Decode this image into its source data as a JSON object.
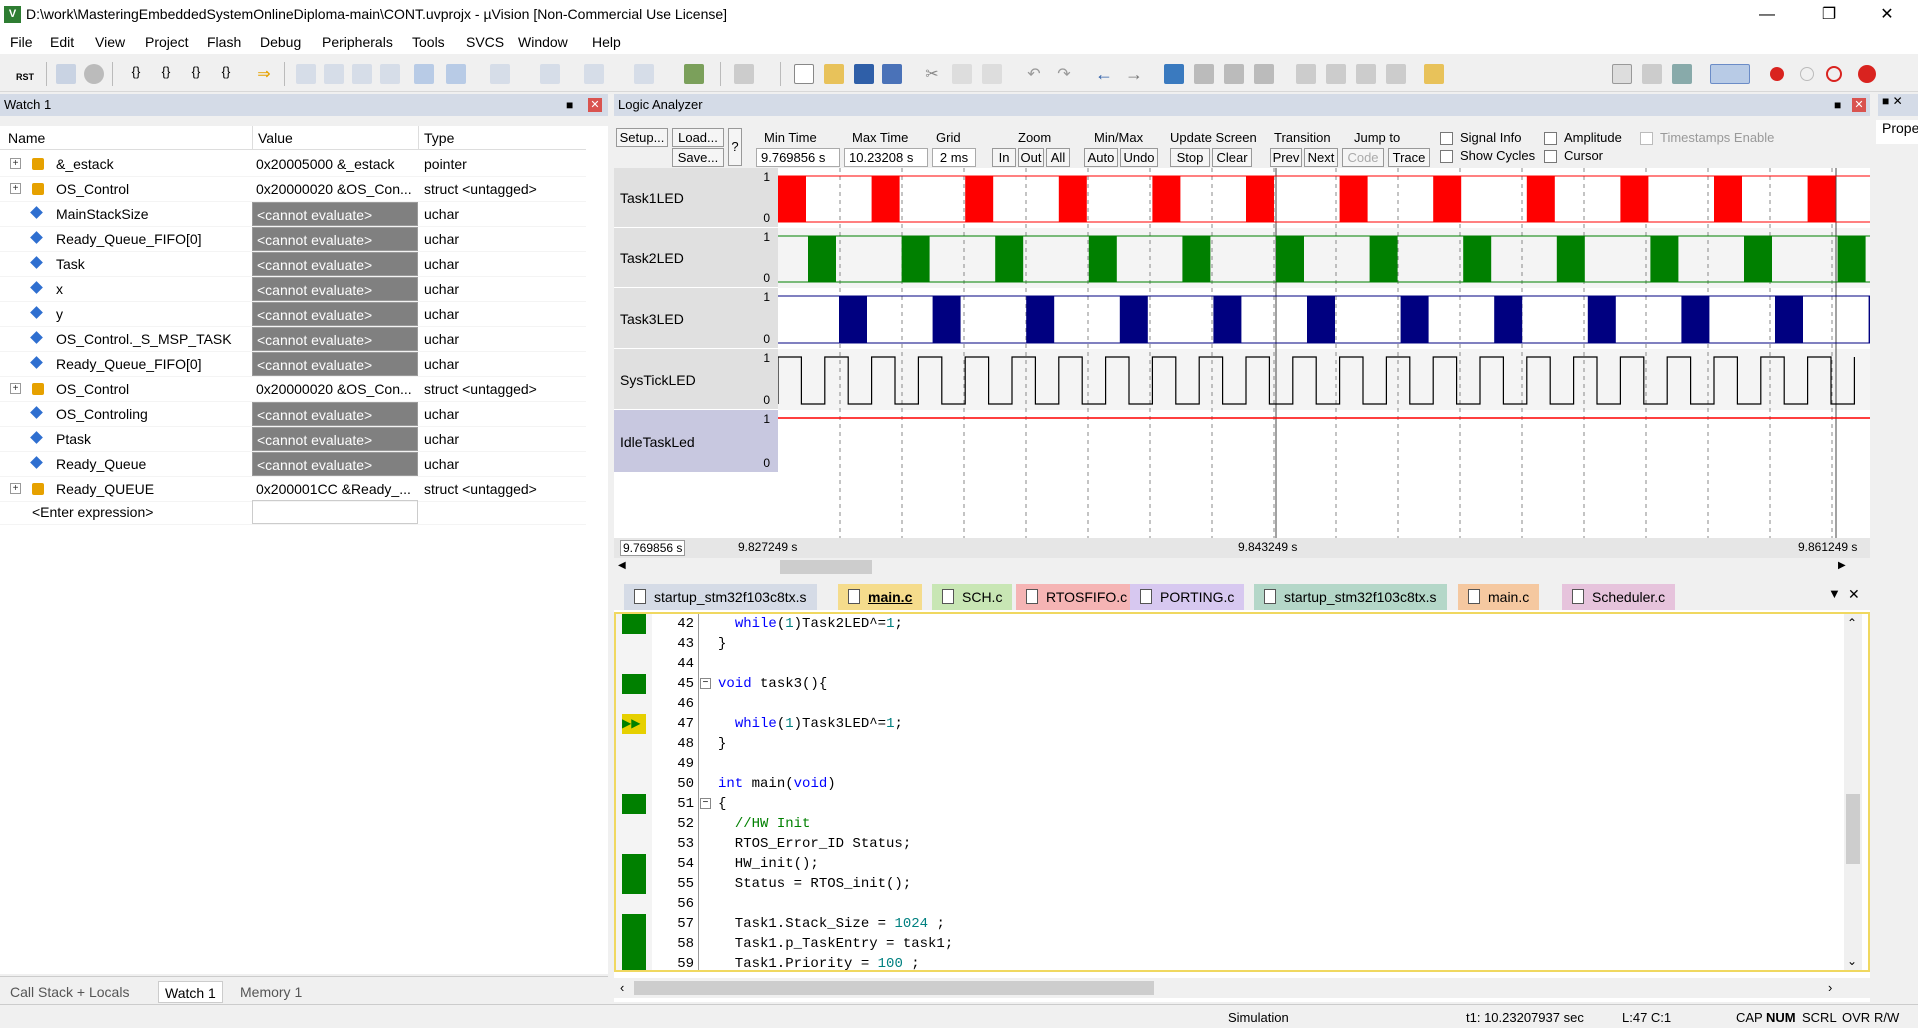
{
  "window": {
    "title": "D:\\work\\MasteringEmbeddedSystemOnlineDiploma-main\\CONT.uvprojx - µVision  [Non-Commercial Use License]"
  },
  "menu": [
    "File",
    "Edit",
    "View",
    "Project",
    "Flash",
    "Debug",
    "Peripherals",
    "Tools",
    "SVCS",
    "Window",
    "Help"
  ],
  "toolbar": {
    "rst_label": "RST"
  },
  "watch": {
    "title": "Watch 1",
    "columns": [
      "Name",
      "Value",
      "Type"
    ],
    "rows": [
      {
        "name": "&_estack",
        "value": "0x20005000 &_estack",
        "type": "pointer",
        "expand": true,
        "grey": false,
        "icon": "struct"
      },
      {
        "name": "OS_Control",
        "value": "0x20000020 &OS_Con...",
        "type": "struct <untagged>",
        "expand": true,
        "grey": false,
        "icon": "struct"
      },
      {
        "name": "MainStackSize",
        "value": "<cannot evaluate>",
        "type": "uchar",
        "expand": false,
        "grey": true,
        "icon": "var"
      },
      {
        "name": "Ready_Queue_FIFO[0]",
        "value": "<cannot evaluate>",
        "type": "uchar",
        "expand": false,
        "grey": true,
        "icon": "var"
      },
      {
        "name": "Task",
        "value": "<cannot evaluate>",
        "type": "uchar",
        "expand": false,
        "grey": true,
        "icon": "var"
      },
      {
        "name": "x",
        "value": "<cannot evaluate>",
        "type": "uchar",
        "expand": false,
        "grey": true,
        "icon": "var"
      },
      {
        "name": "y",
        "value": "<cannot evaluate>",
        "type": "uchar",
        "expand": false,
        "grey": true,
        "icon": "var"
      },
      {
        "name": "OS_Control._S_MSP_TASK",
        "value": "<cannot evaluate>",
        "type": "uchar",
        "expand": false,
        "grey": true,
        "icon": "var"
      },
      {
        "name": "Ready_Queue_FIFO[0]",
        "value": "<cannot evaluate>",
        "type": "uchar",
        "expand": false,
        "grey": true,
        "icon": "var"
      },
      {
        "name": "OS_Control",
        "value": "0x20000020 &OS_Con...",
        "type": "struct <untagged>",
        "expand": true,
        "grey": false,
        "icon": "struct"
      },
      {
        "name": "OS_Controling",
        "value": "<cannot evaluate>",
        "type": "uchar",
        "expand": false,
        "grey": true,
        "icon": "var"
      },
      {
        "name": "Ptask",
        "value": "<cannot evaluate>",
        "type": "uchar",
        "expand": false,
        "grey": true,
        "icon": "var"
      },
      {
        "name": "Ready_Queue",
        "value": "<cannot evaluate>",
        "type": "uchar",
        "expand": false,
        "grey": true,
        "icon": "var"
      },
      {
        "name": "Ready_QUEUE",
        "value": "0x200001CC &Ready_...",
        "type": "struct <untagged>",
        "expand": true,
        "grey": false,
        "icon": "struct"
      }
    ],
    "enter_expression": "<Enter expression>"
  },
  "bottom_tabs": [
    "Call Stack + Locals",
    "Watch 1",
    "Memory 1"
  ],
  "logic": {
    "title": "Logic Analyzer",
    "setup": "Setup...",
    "load": "Load...",
    "save": "Save...",
    "help": "?",
    "min_time_label": "Min Time",
    "min_time": "9.769856 s",
    "max_time_label": "Max Time",
    "max_time": "10.23208 s",
    "grid_label": "Grid",
    "grid": "2 ms",
    "zoom_label": "Zoom",
    "zoom_in": "In",
    "zoom_out": "Out",
    "zoom_all": "All",
    "minmax_label": "Min/Max",
    "auto": "Auto",
    "undo": "Undo",
    "update_label": "Update Screen",
    "stop": "Stop",
    "clear": "Clear",
    "transition_label": "Transition",
    "prev": "Prev",
    "next": "Next",
    "jumpto_label": "Jump to",
    "code": "Code",
    "trace": "Trace",
    "signal_info": "Signal Info",
    "show_cycles": "Show Cycles",
    "amplitude": "Amplitude",
    "cursor": "Cursor",
    "timestamps": "Timestamps Enable",
    "signals": [
      {
        "name": "Task1LED",
        "high": "1",
        "low": "0",
        "color": "#ff0000"
      },
      {
        "name": "Task2LED",
        "high": "1",
        "low": "0",
        "color": "#008000"
      },
      {
        "name": "Task3LED",
        "high": "1",
        "low": "0",
        "color": "#000080"
      },
      {
        "name": "SysTickLED",
        "high": "1",
        "low": "0",
        "color": "#000000"
      },
      {
        "name": "IdleTaskLed",
        "high": "1",
        "low": "0",
        "color": "#ff0000"
      }
    ],
    "time_start": "9.769856 s",
    "time_marks": [
      "9.827249 s",
      "9.843249 s",
      "9.861249 s"
    ]
  },
  "properties_label": "Prope",
  "editor": {
    "tabs": [
      {
        "label": "startup_stm32f103c8tx.s",
        "color": "#d5dbe6"
      },
      {
        "label": "main.c",
        "color": "#f5dc8c",
        "active": true
      },
      {
        "label": "SCH.c",
        "color": "#c8e6b4"
      },
      {
        "label": "RTOSFIFO.c",
        "color": "#f5b4b4"
      },
      {
        "label": "PORTING.c",
        "color": "#d7c8f0"
      },
      {
        "label": "startup_stm32f103c8tx.s",
        "color": "#b4d7c8"
      },
      {
        "label": "main.c",
        "color": "#f5c8a0"
      },
      {
        "label": "Scheduler.c",
        "color": "#e6c3dc"
      }
    ],
    "lines": [
      {
        "n": "42",
        "html": "  <span class=kw>while</span>(<span class=nu>1</span>)Task2LED^=<span class=nu>1</span>;",
        "g": true,
        "fold": false
      },
      {
        "n": "43",
        "html": "}",
        "g": false,
        "fold": false
      },
      {
        "n": "44",
        "html": "",
        "g": false,
        "fold": false
      },
      {
        "n": "45",
        "html": "<span class=kw>void</span> task3(){",
        "g": true,
        "fold": true
      },
      {
        "n": "46",
        "html": "",
        "g": false,
        "fold": false
      },
      {
        "n": "47",
        "html": "  <span class=kw>while</span>(<span class=nu>1</span>)Task3LED^=<span class=nu>1</span>;",
        "g": false,
        "fold": false,
        "arrow": true
      },
      {
        "n": "48",
        "html": "}",
        "g": false,
        "fold": false
      },
      {
        "n": "49",
        "html": "",
        "g": false,
        "fold": false
      },
      {
        "n": "50",
        "html": "<span class=kw>int</span> main(<span class=kw>void</span>)",
        "g": false,
        "fold": false
      },
      {
        "n": "51",
        "html": "{",
        "g": true,
        "fold": true
      },
      {
        "n": "52",
        "html": "  <span class=cm>//HW Init</span>",
        "g": false,
        "fold": false
      },
      {
        "n": "53",
        "html": "  RTOS_Error_ID Status;",
        "g": false,
        "fold": false
      },
      {
        "n": "54",
        "html": "  HW_init();",
        "g": true,
        "fold": false
      },
      {
        "n": "55",
        "html": "  Status = RTOS_init();",
        "g": true,
        "fold": false
      },
      {
        "n": "56",
        "html": "",
        "g": false,
        "fold": false
      },
      {
        "n": "57",
        "html": "  Task1.Stack_Size = <span class=nu>1024</span> ;",
        "g": true,
        "fold": false
      },
      {
        "n": "58",
        "html": "  Task1.p_TaskEntry = task1;",
        "g": true,
        "fold": false
      },
      {
        "n": "59",
        "html": "  Task1.Priority = <span class=nu>100</span> ;",
        "g": true,
        "fold": false
      }
    ]
  },
  "status": {
    "mode": "Simulation",
    "t1": "t1: 10.23207937 sec",
    "pos": "L:47 C:1",
    "caps": "CAP",
    "num": "NUM",
    "scrl": "SCRL",
    "ovr": "OVR",
    "rw": "R/W"
  }
}
